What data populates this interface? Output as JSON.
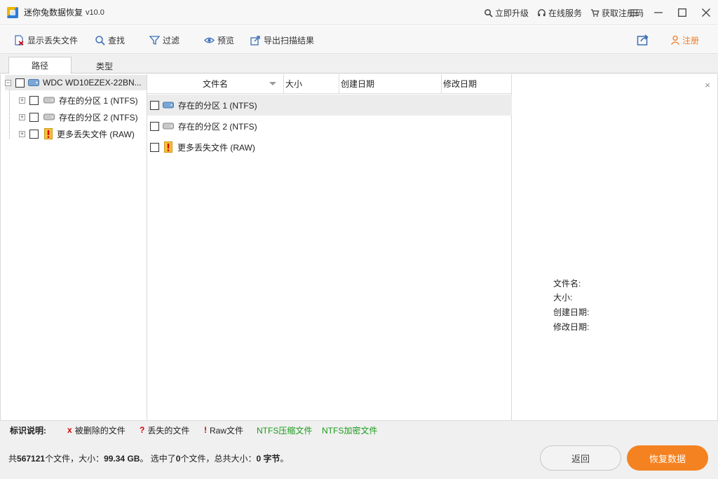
{
  "app": {
    "title": "迷你兔数据恢复",
    "version": "v10.0"
  },
  "title_links": {
    "upgrade": "立即升级",
    "support": "在线服务",
    "get_code": "获取注册码"
  },
  "toolbar": {
    "show_lost": "显示丢失文件",
    "find": "查找",
    "filter": "过滤",
    "preview": "预览",
    "export": "导出扫描结果",
    "register": "注册"
  },
  "tabs": {
    "path": "路径",
    "type": "类型"
  },
  "tree": {
    "root": "WDC WD10EZEX-22BN...",
    "items": [
      "存在的分区 1 (NTFS)",
      "存在的分区 2 (NTFS)",
      "更多丢失文件 (RAW)"
    ]
  },
  "columns": {
    "name": "文件名",
    "size": "大小",
    "created": "创建日期",
    "modified": "修改日期"
  },
  "files": [
    "存在的分区 1 (NTFS)",
    "存在的分区 2 (NTFS)",
    "更多丢失文件 (RAW)"
  ],
  "preview": {
    "close": "×",
    "name_label": "文件名:",
    "size_label": "大小:",
    "created_label": "创建日期:",
    "modified_label": "修改日期:"
  },
  "legend": {
    "title": "标识说明:",
    "deleted_mark": "x",
    "deleted": "被删除的文件",
    "lost_mark": "?",
    "lost": "丢失的文件",
    "raw_mark": "!",
    "raw": "Raw文件",
    "ntfs_compressed": "NTFS压缩文件",
    "ntfs_encrypted": "NTFS加密文件"
  },
  "status": {
    "p1": "共",
    "file_count": "567121",
    "p2": "个文件，大小：",
    "total_size": "99.34 GB",
    "p3": "。 选中了",
    "selected_count": "0",
    "p4": "个文件，总共大小：",
    "selected_size": "0 字节",
    "p5": "。"
  },
  "buttons": {
    "back": "返回",
    "recover": "恢复数据"
  },
  "colors": {
    "accent": "#f58220",
    "ntfs_compressed": "#1a9a1a",
    "ntfs_encrypted": "#1a9a1a",
    "deleted_mark": "#d00000"
  }
}
